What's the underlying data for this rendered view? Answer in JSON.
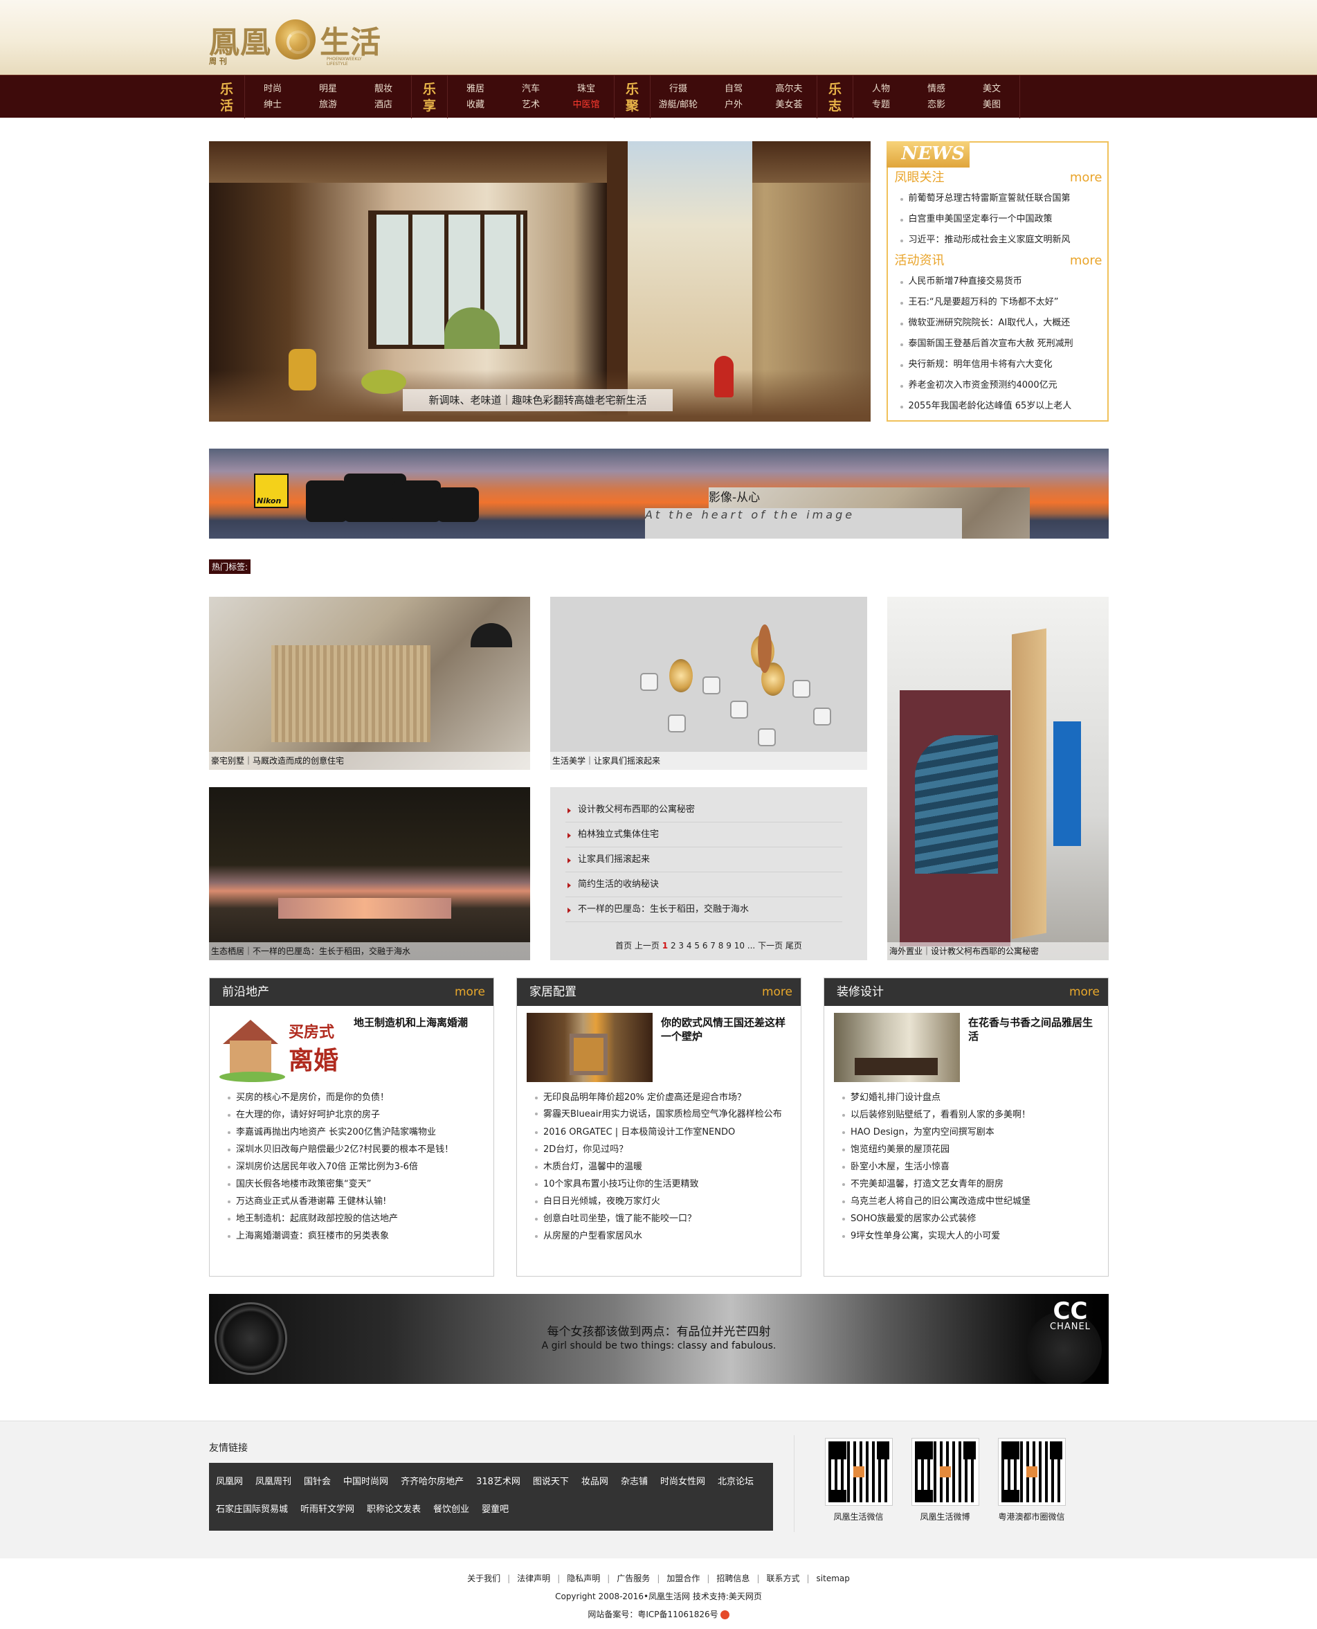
{
  "header": {
    "logo_left": "鳳凰",
    "logo_right": "生活",
    "logo_sub": "周 刊",
    "logo_en": "PHOENIXWEEKLY LIFESTYLE"
  },
  "nav": [
    {
      "big": [
        "乐",
        "活"
      ],
      "cols": [
        [
          "时尚",
          "绅士"
        ],
        [
          "明星",
          "旅游"
        ],
        [
          "靓妆",
          "酒店"
        ]
      ]
    },
    {
      "big": [
        "乐",
        "享"
      ],
      "cols": [
        [
          "雅居",
          "收藏"
        ],
        [
          "汽车",
          "艺术"
        ],
        [
          "珠宝",
          "中医馆"
        ]
      ]
    },
    {
      "big": [
        "乐",
        "聚"
      ],
      "cols": [
        [
          "行摄",
          "游艇/邮轮"
        ],
        [
          "自驾",
          "户外"
        ],
        [
          "高尔夫",
          "美女荟"
        ]
      ]
    },
    {
      "big": [
        "乐",
        "志"
      ],
      "cols": [
        [
          "人物",
          "专题"
        ],
        [
          "情感",
          "恋影"
        ],
        [
          "美文",
          "美图"
        ]
      ]
    }
  ],
  "slide": {
    "caption": "新调味、老味道｜趣味色彩翻转高雄老宅新生活"
  },
  "news": {
    "badge": "NEWS",
    "sec1": {
      "title": "凤眼关注",
      "more": "more",
      "items": [
        "前葡萄牙总理古特雷斯宣誓就任联合国第",
        "白宫重申美国坚定奉行一个中国政策",
        "习近平：推动形成社会主义家庭文明新风"
      ]
    },
    "sec2": {
      "title": "活动资讯",
      "more": "more",
      "items": [
        "人民币新增7种直接交易货币",
        "王石:“凡是要超万科的 下场都不太好”",
        "微软亚洲研究院院长：AI取代人，大概还",
        "泰国新国王登基后首次宣布大赦 死刑减刑",
        "央行新规：明年信用卡将有六大变化",
        "养老金初次入市资金预测约4000亿元",
        "2055年我国老龄化达峰值 65岁以上老人"
      ]
    }
  },
  "nikon_banner": {
    "brand": "Nikon",
    "title": "影像-从心",
    "subtitle": "At the heart of the image"
  },
  "hot_tag": "热门标签:",
  "tiles": {
    "t1": "豪宅别墅｜马厩改造而成的创意住宅",
    "t2": "生活美学｜让家具们摇滚起来",
    "t3": "海外置业｜设计教父柯布西耶的公寓秘密",
    "t4": "生态栖居｜不一样的巴厘岛：生长于稻田，交融于海水"
  },
  "list_box": {
    "items": [
      "设计教父柯布西耶的公寓秘密",
      "柏林独立式集体住宅",
      "让家具们摇滚起来",
      "简约生活的收纳秘诀",
      "不一样的巴厘岛：生长于稻田，交融于海水"
    ],
    "pager": {
      "first": "首页",
      "prev": "上一页",
      "current": "1",
      "pages": [
        "2",
        "3",
        "4",
        "5",
        "6",
        "7",
        "8",
        "9",
        "10",
        "..."
      ],
      "next": "下一页",
      "last": "尾页"
    }
  },
  "boxes": [
    {
      "title": "前沿地产",
      "more": "more",
      "feat": "地王制造机和上海离婚潮",
      "thumb_text1": "买房式",
      "thumb_text2": "离婚",
      "items": [
        "买房的核心不是房价，而是你的负债！",
        "在大理的你，请好好呵护北京的房子",
        "李嘉诚再抛出内地资产 长实200亿售沪陆家嘴物业",
        "深圳水贝旧改每户赔偿最少2亿?村民要的根本不是钱！",
        "深圳房价达居民年收入70倍 正常比例为3-6倍",
        "国庆长假各地楼市政策密集“变天”",
        "万达商业正式从香港谢幕 王健林认输!",
        "地王制造机：起底财政部控股的信达地产",
        "上海离婚潮调查：疯狂楼市的另类表象"
      ]
    },
    {
      "title": "家居配置",
      "more": "more",
      "feat": "你的欧式风情王国还差这样一个壁炉",
      "items": [
        "无印良品明年降价超20% 定价虚高还是迎合市场？",
        "雾霾天Blueair用实力说话，国家质检局空气净化器样检公布",
        "2016 ORGATEC | 日本极简设计工作室NENDO",
        "2D台灯，你见过吗？",
        "木质台灯，温馨中的温暖",
        "10个家具布置小技巧让你的生活更精致",
        "白日日光倾城，夜晚万家灯火",
        "创意白吐司坐垫，饿了能不能咬一口？",
        "从房屋的户型看家居风水"
      ]
    },
    {
      "title": "装修设计",
      "more": "more",
      "feat": "在花香与书香之间品雅居生活",
      "items": [
        "梦幻婚礼排门设计盘点",
        "以后装修别贴壁纸了，看看别人家的多美啊！",
        "HAO Design，为室内空间撰写剧本",
        "饱览纽约美景的屋顶花园",
        "卧室小木屋，生活小惊喜",
        "不完美却温馨，打造文艺女青年的厨房",
        "乌克兰老人将自己的旧公寓改造成中世纪城堡",
        "SOHO族最爱的居家办公式装修",
        "9坪女性单身公寓，实现大人的小可爱"
      ]
    }
  ],
  "chanel_banner": {
    "title": "每个女孩都该做到两点：有品位并光芒四射",
    "subtitle": "A girl should be two things: classy and fabulous.",
    "brand": "CHANEL",
    "mark": "CC"
  },
  "footer": {
    "links_title": "友情链接",
    "links": [
      "凤凰网",
      "凤凰周刊",
      "国针会",
      "中国时尚网",
      "齐齐哈尔房地产",
      "318艺术网",
      "图说天下",
      "妆品网",
      "杂志铺",
      "时尚女性网",
      "北京论坛",
      "石家庄国际贸易城",
      "听雨轩文学网",
      "职称论文发表",
      "餐饮创业",
      "婴童吧"
    ],
    "qrs": [
      "凤凰生活微信",
      "凤凰生活微博",
      "粤港澳都市圈微信"
    ]
  },
  "bottom": {
    "links": [
      "关于我们",
      "法律声明",
      "隐私声明",
      "广告服务",
      "加盟合作",
      "招聘信息",
      "联系方式",
      "sitemap"
    ],
    "copyright": "Copyright 2008-2016•凤凰生活网 技术支持:美天网页",
    "icp": "网站备案号：粤ICP备11061826号"
  }
}
